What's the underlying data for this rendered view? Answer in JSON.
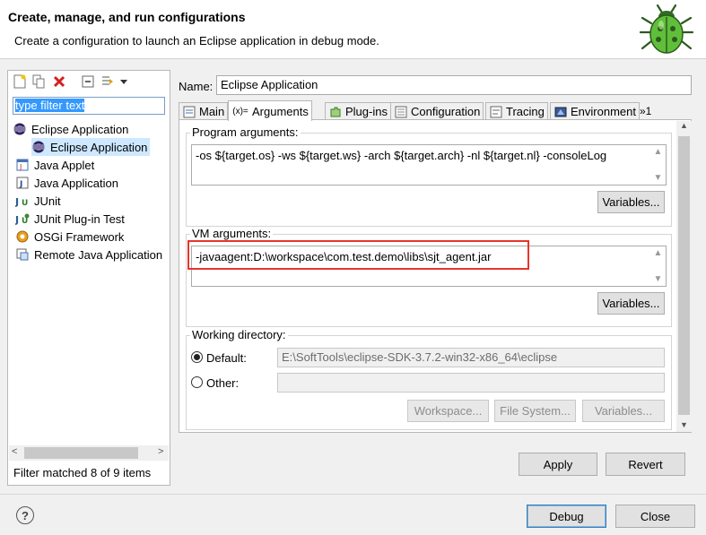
{
  "header": {
    "title": "Create, manage, and run configurations",
    "subtitle": "Create a configuration to launch an Eclipse application in debug mode."
  },
  "left": {
    "filter_text": "type filter text",
    "tree": [
      {
        "label": "Eclipse Application",
        "icon": "eclipse-icon"
      },
      {
        "label": "Eclipse Application",
        "icon": "eclipse-icon"
      },
      {
        "label": "Java Applet",
        "icon": "java-applet-icon"
      },
      {
        "label": "Java Application",
        "icon": "java-application-icon"
      },
      {
        "label": "JUnit",
        "icon": "junit-icon"
      },
      {
        "label": "JUnit Plug-in Test",
        "icon": "junit-plugin-icon"
      },
      {
        "label": "OSGi Framework",
        "icon": "osgi-icon"
      },
      {
        "label": "Remote Java Application",
        "icon": "remote-java-icon"
      }
    ],
    "status": "Filter matched 8 of 9 items"
  },
  "config": {
    "name_label": "Name:",
    "name_value": "Eclipse Application",
    "tabs": [
      {
        "label": "Main"
      },
      {
        "label": "Arguments"
      },
      {
        "label": "Plug-ins"
      },
      {
        "label": "Configuration"
      },
      {
        "label": "Tracing"
      },
      {
        "label": "Environment"
      },
      {
        "label": "»1"
      }
    ],
    "program_args_label": "Program arguments:",
    "program_args_value": "-os ${target.os} -ws ${target.ws} -arch ${target.arch} -nl ${target.nl} -consoleLog",
    "vm_args_label": "VM arguments:",
    "vm_args_value": "-javaagent:D:\\workspace\\com.test.demo\\libs\\sjt_agent.jar",
    "variables_label": "Variables...",
    "working_dir_label": "Working directory:",
    "default_label": "Default:",
    "default_value": "E:\\SoftTools\\eclipse-SDK-3.7.2-win32-x86_64\\eclipse",
    "other_label": "Other:",
    "workspace_btn": "Workspace...",
    "filesystem_btn": "File System...",
    "variables2_btn": "Variables...",
    "apply": "Apply",
    "revert": "Revert"
  },
  "footer": {
    "help": "?",
    "debug": "Debug",
    "close": "Close"
  },
  "colors": {
    "highlight": "#e8352b",
    "selection": "#3399ff"
  }
}
